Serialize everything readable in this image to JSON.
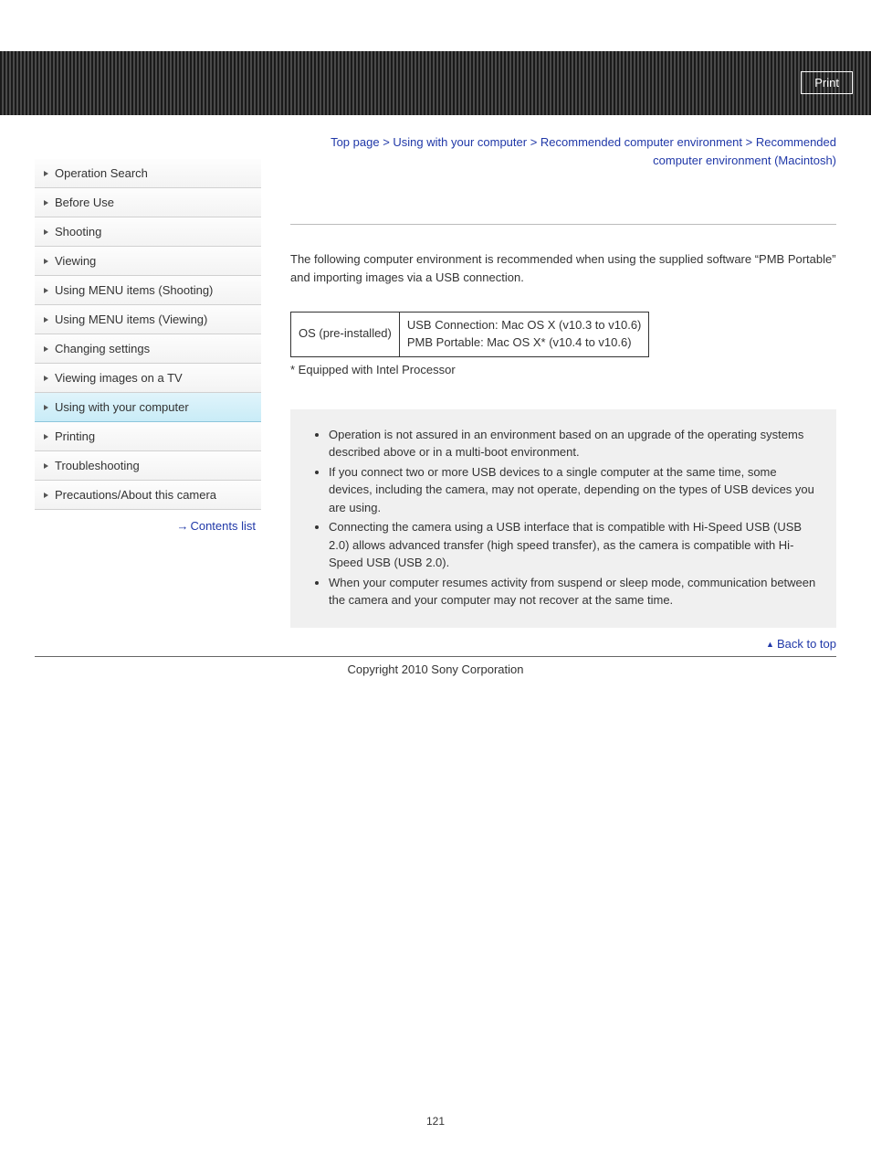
{
  "header": {
    "print_label": "Print"
  },
  "sidebar": {
    "items": [
      {
        "label": "Operation Search",
        "active": false
      },
      {
        "label": "Before Use",
        "active": false
      },
      {
        "label": "Shooting",
        "active": false
      },
      {
        "label": "Viewing",
        "active": false
      },
      {
        "label": "Using MENU items (Shooting)",
        "active": false
      },
      {
        "label": "Using MENU items (Viewing)",
        "active": false
      },
      {
        "label": "Changing settings",
        "active": false
      },
      {
        "label": "Viewing images on a TV",
        "active": false
      },
      {
        "label": "Using with your computer",
        "active": true
      },
      {
        "label": "Printing",
        "active": false
      },
      {
        "label": "Troubleshooting",
        "active": false
      },
      {
        "label": "Precautions/About this camera",
        "active": false
      }
    ],
    "contents_link": "Contents list"
  },
  "breadcrumb": {
    "parts": [
      "Top page",
      "Using with your computer",
      "Recommended computer environment",
      "Recommended computer environment (Macintosh)"
    ],
    "sep": " > "
  },
  "content": {
    "intro": "The following computer environment is recommended when using the supplied software “PMB Portable” and importing images via a USB connection.",
    "table": {
      "row_label": "OS (pre-installed)",
      "cell_line1": "USB Connection: Mac OS X (v10.3 to v10.6)",
      "cell_line2": "PMB Portable: Mac OS X* (v10.4 to v10.6)"
    },
    "footnote": "* Equipped with Intel Processor",
    "notes": [
      "Operation is not assured in an environment based on an upgrade of the operating systems described above or in a multi-boot environment.",
      "If you connect two or more USB devices to a single computer at the same time, some devices, including the camera, may not operate, depending on the types of USB devices you are using.",
      "Connecting the camera using a USB interface that is compatible with Hi-Speed USB (USB 2.0) allows advanced transfer (high speed transfer), as the camera is compatible with Hi-Speed USB (USB 2.0).",
      "When your computer resumes activity from suspend or sleep mode, communication between the camera and your computer may not recover at the same time."
    ],
    "back_to_top": "Back to top"
  },
  "footer": {
    "copyright": "Copyright 2010 Sony Corporation",
    "page_number": "121"
  }
}
